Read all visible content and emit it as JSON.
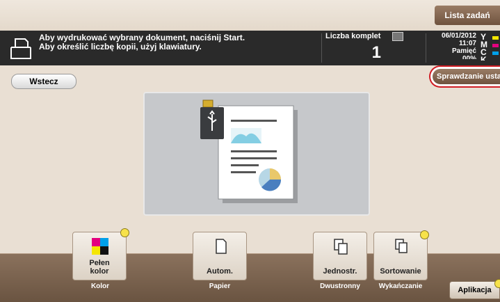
{
  "header": {
    "job_list_tab": "Lista zadań"
  },
  "message": {
    "line1": "Aby wydrukować wybrany dokument, naciśnij Start.",
    "line2": "Aby określić liczbę kopii, użyj klawiatury."
  },
  "copies": {
    "label": "Liczba komplet",
    "value": "1"
  },
  "status": {
    "date": "06/01/2012",
    "time": "11:07",
    "memory_label": "Pamięć",
    "memory_value": "00%",
    "toner": [
      {
        "letter": "Y",
        "color": "#f5e600"
      },
      {
        "letter": "M",
        "color": "#e4007f"
      },
      {
        "letter": "C",
        "color": "#00a0e9"
      },
      {
        "letter": "K",
        "color": "#222222"
      }
    ]
  },
  "nav": {
    "back_label": "Wstecz",
    "check_settings_label": "Sprawdzanie ustawień"
  },
  "preview": {
    "media_icon": "usb-icon"
  },
  "function_buttons": [
    {
      "id": "color",
      "label": "Pełen\nkolor",
      "category": "Kolor",
      "has_dot": true,
      "icon": "color-squares-icon"
    },
    {
      "id": "paper",
      "label": "Autom.",
      "category": "Papier",
      "has_dot": false,
      "icon": "paper-icon"
    },
    {
      "id": "duplex",
      "label": "Jednostr.",
      "category": "Dwustronny",
      "has_dot": false,
      "icon": "simplex-icon"
    },
    {
      "id": "finishing",
      "label": "Sortowanie",
      "category": "Wykańczanie",
      "has_dot": true,
      "icon": "sort-icon"
    }
  ],
  "app_button": {
    "label": "Aplikacja"
  },
  "colors": {
    "accent_brown": "#7a5e48",
    "highlight_red": "#d01c24",
    "message_bar": "#2a2a2a"
  }
}
